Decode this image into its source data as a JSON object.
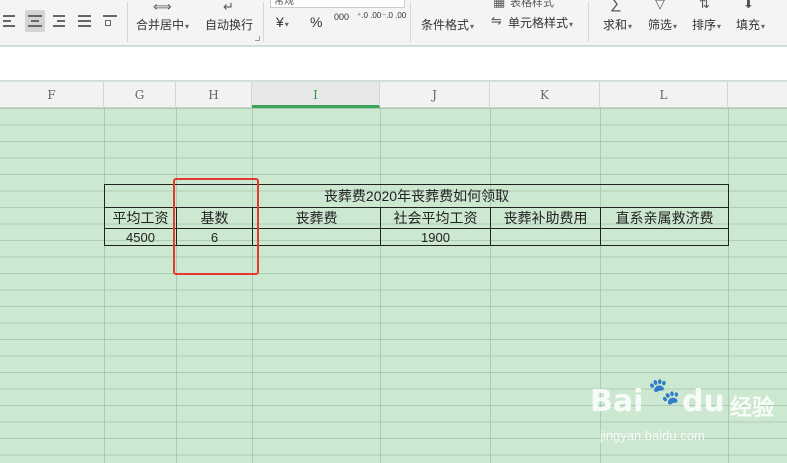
{
  "ribbon": {
    "merge_center": "合并居中",
    "auto_wrap": "自动换行",
    "currency_symbol": "¥",
    "percent_symbol": "%",
    "thousands": "000",
    "inc_decimal": "⁺.0 .00",
    "dec_decimal": "⁻.0 .00",
    "cond_format": "条件格式",
    "cell_style": "单元格样式",
    "table_style_partial": "表格样式",
    "number_format_partial": "常规",
    "sum": "求和",
    "filter": "筛选",
    "sort": "排序",
    "fill": "填充"
  },
  "columns": [
    "F",
    "G",
    "H",
    "I",
    "J",
    "K",
    "L"
  ],
  "active_column": "I",
  "table": {
    "title": "丧葬费2020年丧葬费如何领取",
    "headers": [
      "平均工资",
      "基数",
      "丧葬费",
      "社会平均工资",
      "丧葬补助费用",
      "直系亲属救济费"
    ],
    "row": [
      "4500",
      "6",
      "",
      "1900",
      "",
      ""
    ]
  },
  "watermark": {
    "brand": "Bai",
    "brand2": "du",
    "cn": "经验",
    "url": "jingyan.baidu.com"
  },
  "colors": {
    "grid_bg": "#cde8d0",
    "highlight": "#e23a2e",
    "active_col": "#3aa357"
  }
}
